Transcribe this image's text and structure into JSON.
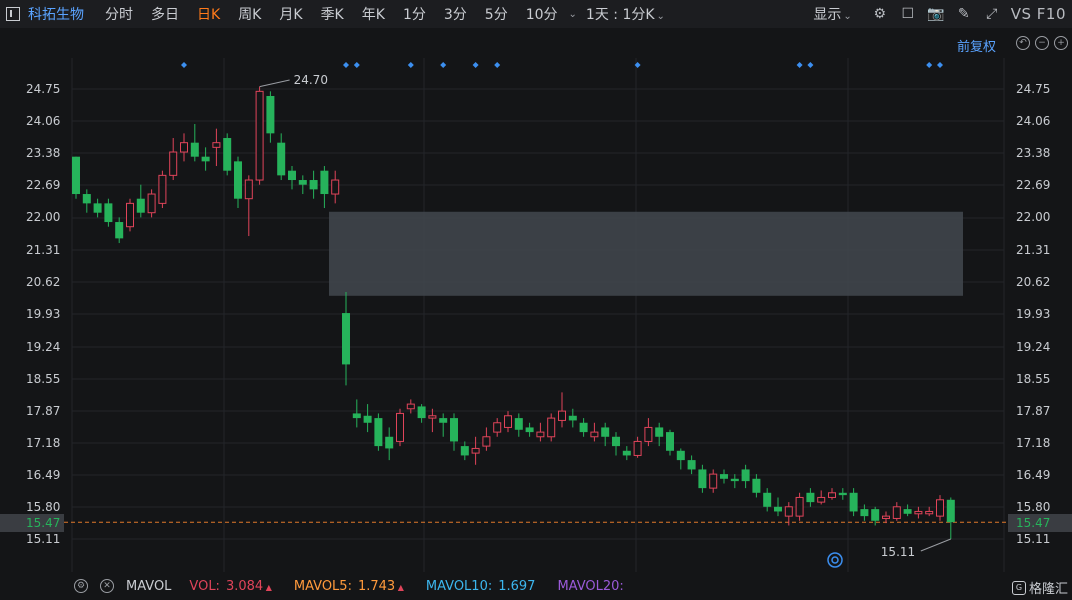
{
  "toolbar": {
    "stock_name": "科拓生物",
    "periods": [
      "分时",
      "多日",
      "日K",
      "周K",
      "月K",
      "季K",
      "年K",
      "1分",
      "3分",
      "5分",
      "10分"
    ],
    "active_period": "日K",
    "more_caret": "⌄",
    "combo_label": "1天 : 1分K",
    "display_label": "显示",
    "vs_f10": "VS F10"
  },
  "subbar": {
    "adjust_label": "前复权"
  },
  "axis": {
    "price_ticks": [
      "24.75",
      "24.06",
      "23.38",
      "22.69",
      "22.00",
      "21.31",
      "20.62",
      "19.93",
      "19.24",
      "18.55",
      "17.87",
      "17.18",
      "16.49",
      "15.80",
      "15.11"
    ],
    "current_price": "15.47"
  },
  "chart_data": {
    "type": "candlestick",
    "high_label": "24.70",
    "low_label": "15.11",
    "up_color": "#e0445a",
    "down_color": "#26b35b",
    "gap_box": {
      "from_price": 22.12,
      "to_price": 20.32
    },
    "candles": [
      [
        23.3,
        22.5,
        23.3,
        22.4
      ],
      [
        22.5,
        22.3,
        22.6,
        22.1
      ],
      [
        22.3,
        22.1,
        22.4,
        22.0
      ],
      [
        22.3,
        21.9,
        22.4,
        21.8
      ],
      [
        21.9,
        21.55,
        22.0,
        21.45
      ],
      [
        21.8,
        22.3,
        22.4,
        21.7
      ],
      [
        22.4,
        22.1,
        22.7,
        22.0
      ],
      [
        22.1,
        22.5,
        22.6,
        22.0
      ],
      [
        22.3,
        22.9,
        23.0,
        22.2
      ],
      [
        22.9,
        23.4,
        23.7,
        22.8
      ],
      [
        23.4,
        23.6,
        23.8,
        23.2
      ],
      [
        23.6,
        23.3,
        24.0,
        23.2
      ],
      [
        23.3,
        23.2,
        23.5,
        23.0
      ],
      [
        23.5,
        23.6,
        23.9,
        23.1
      ],
      [
        23.7,
        23.0,
        23.8,
        22.9
      ],
      [
        23.2,
        22.4,
        23.3,
        22.2
      ],
      [
        22.4,
        22.8,
        22.9,
        21.6
      ],
      [
        22.8,
        24.7,
        24.8,
        22.7
      ],
      [
        24.6,
        23.8,
        24.7,
        23.6
      ],
      [
        23.6,
        22.9,
        23.8,
        22.8
      ],
      [
        23.0,
        22.8,
        23.1,
        22.6
      ],
      [
        22.8,
        22.7,
        22.9,
        22.5
      ],
      [
        22.8,
        22.6,
        23.0,
        22.4
      ],
      [
        23.0,
        22.5,
        23.1,
        22.2
      ],
      [
        22.5,
        22.8,
        23.0,
        22.3
      ],
      [
        19.95,
        18.85,
        20.4,
        18.4
      ],
      [
        17.8,
        17.7,
        18.1,
        17.5
      ],
      [
        17.75,
        17.6,
        18.0,
        17.4
      ],
      [
        17.7,
        17.1,
        17.8,
        17.0
      ],
      [
        17.3,
        17.05,
        17.5,
        16.8
      ],
      [
        17.2,
        17.8,
        17.9,
        17.1
      ],
      [
        17.9,
        18.0,
        18.1,
        17.8
      ],
      [
        17.95,
        17.7,
        18.0,
        17.6
      ],
      [
        17.7,
        17.75,
        17.9,
        17.4
      ],
      [
        17.7,
        17.6,
        17.8,
        17.3
      ],
      [
        17.7,
        17.2,
        17.8,
        17.0
      ],
      [
        17.1,
        16.9,
        17.2,
        16.8
      ],
      [
        16.95,
        17.05,
        17.3,
        16.7
      ],
      [
        17.1,
        17.3,
        17.5,
        17.0
      ],
      [
        17.4,
        17.6,
        17.7,
        17.3
      ],
      [
        17.5,
        17.75,
        17.85,
        17.4
      ],
      [
        17.7,
        17.45,
        17.8,
        17.3
      ],
      [
        17.5,
        17.4,
        17.6,
        17.3
      ],
      [
        17.3,
        17.4,
        17.6,
        17.2
      ],
      [
        17.3,
        17.7,
        17.8,
        17.2
      ],
      [
        17.65,
        17.85,
        18.25,
        17.5
      ],
      [
        17.75,
        17.65,
        17.9,
        17.5
      ],
      [
        17.6,
        17.4,
        17.7,
        17.3
      ],
      [
        17.3,
        17.4,
        17.6,
        17.2
      ],
      [
        17.5,
        17.3,
        17.6,
        17.1
      ],
      [
        17.3,
        17.1,
        17.4,
        16.9
      ],
      [
        17.0,
        16.9,
        17.1,
        16.8
      ],
      [
        16.9,
        17.2,
        17.3,
        16.85
      ],
      [
        17.2,
        17.5,
        17.7,
        17.1
      ],
      [
        17.5,
        17.3,
        17.6,
        17.1
      ],
      [
        17.4,
        17.0,
        17.45,
        16.9
      ],
      [
        17.0,
        16.8,
        17.05,
        16.6
      ],
      [
        16.8,
        16.6,
        16.9,
        16.5
      ],
      [
        16.6,
        16.2,
        16.7,
        16.1
      ],
      [
        16.2,
        16.5,
        16.6,
        16.1
      ],
      [
        16.5,
        16.4,
        16.6,
        16.3
      ],
      [
        16.4,
        16.35,
        16.5,
        16.2
      ],
      [
        16.6,
        16.35,
        16.7,
        16.2
      ],
      [
        16.4,
        16.1,
        16.5,
        16.0
      ],
      [
        16.1,
        15.8,
        16.2,
        15.7
      ],
      [
        15.8,
        15.7,
        16.0,
        15.6
      ],
      [
        15.6,
        15.8,
        15.9,
        15.4
      ],
      [
        15.6,
        16.0,
        16.1,
        15.5
      ],
      [
        16.1,
        15.9,
        16.2,
        15.8
      ],
      [
        15.9,
        16.0,
        16.15,
        15.85
      ],
      [
        16.0,
        16.1,
        16.2,
        15.95
      ],
      [
        16.1,
        16.05,
        16.2,
        15.95
      ],
      [
        16.1,
        15.7,
        16.2,
        15.6
      ],
      [
        15.75,
        15.6,
        15.85,
        15.5
      ],
      [
        15.75,
        15.5,
        15.8,
        15.4
      ],
      [
        15.55,
        15.6,
        15.7,
        15.45
      ],
      [
        15.55,
        15.8,
        15.9,
        15.5
      ],
      [
        15.75,
        15.65,
        15.85,
        15.6
      ],
      [
        15.65,
        15.7,
        15.8,
        15.55
      ],
      [
        15.65,
        15.7,
        15.8,
        15.6
      ],
      [
        15.6,
        15.95,
        16.05,
        15.5
      ],
      [
        15.95,
        15.47,
        16.0,
        15.11
      ]
    ],
    "markers_at_candle": [
      10,
      25,
      26,
      31,
      34,
      37,
      39,
      52,
      67,
      68,
      79,
      80
    ]
  },
  "bottom": {
    "mavol_label": "MAVOL",
    "vol_label": "VOL:",
    "vol_value": "3.084",
    "mavol5_label": "MAVOL5:",
    "mavol5_value": "1.743",
    "mavol10_label": "MAVOL10:",
    "mavol10_value": "1.697",
    "mavol20_label": "MAVOL20:",
    "brand": "格隆汇"
  },
  "colors": {
    "up": "#e0445a",
    "down": "#26b35b",
    "accent": "#ff7a1a",
    "link": "#5aa3ff"
  }
}
